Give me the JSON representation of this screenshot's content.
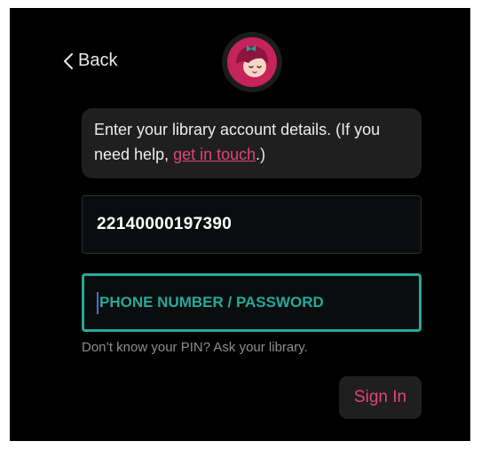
{
  "header": {
    "back_label": "Back",
    "back_icon": "chevron-left-icon",
    "logo_icon": "libby-logo-icon"
  },
  "info": {
    "text_before": "Enter your library account details. (If you need help, ",
    "link_text": "get in touch",
    "text_after": ".)"
  },
  "form": {
    "card_number": "22140000197390",
    "pin_placeholder": "PHONE NUMBER / PASSWORD",
    "pin_value": "",
    "hint": "Don’t know your PIN? Ask your library.",
    "signin_label": "Sign In"
  },
  "colors": {
    "accent": "#e0447c",
    "focus": "#2aa79b",
    "background": "#000000",
    "panel": "#1f1f1f"
  }
}
